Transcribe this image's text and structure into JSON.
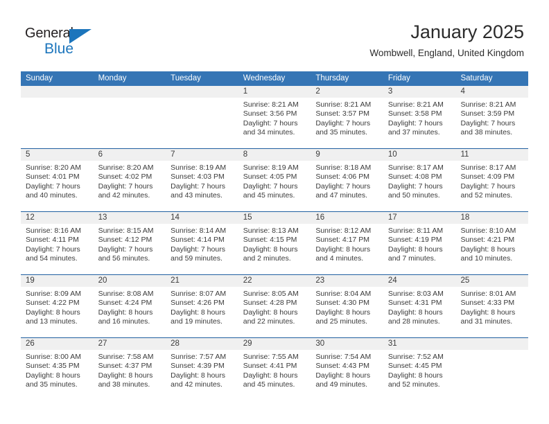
{
  "brand": {
    "name_part1": "General",
    "name_part2": "Blue",
    "triangle_icon": "triangle-logo-icon",
    "color_dark": "#231f20",
    "color_blue": "#1c75bc"
  },
  "header": {
    "title": "January 2025",
    "subtitle": "Wombwell, England, United Kingdom"
  },
  "theme": {
    "header_blue": "#3575B5",
    "separator_blue": "#1F5FA0",
    "daynum_band": "#f0f0f0",
    "text": "#3a3a3a"
  },
  "weekdays": [
    "Sunday",
    "Monday",
    "Tuesday",
    "Wednesday",
    "Thursday",
    "Friday",
    "Saturday"
  ],
  "labels": {
    "sunrise_prefix": "Sunrise: ",
    "sunset_prefix": "Sunset: ",
    "daylight_prefix": "Daylight: "
  },
  "weeks": [
    {
      "days": [
        {
          "num": "",
          "empty": true
        },
        {
          "num": "",
          "empty": true
        },
        {
          "num": "",
          "empty": true
        },
        {
          "num": "1",
          "sunrise": "Sunrise: 8:21 AM",
          "sunset": "Sunset: 3:56 PM",
          "daylight_1": "Daylight: 7 hours",
          "daylight_2": "and 34 minutes."
        },
        {
          "num": "2",
          "sunrise": "Sunrise: 8:21 AM",
          "sunset": "Sunset: 3:57 PM",
          "daylight_1": "Daylight: 7 hours",
          "daylight_2": "and 35 minutes."
        },
        {
          "num": "3",
          "sunrise": "Sunrise: 8:21 AM",
          "sunset": "Sunset: 3:58 PM",
          "daylight_1": "Daylight: 7 hours",
          "daylight_2": "and 37 minutes."
        },
        {
          "num": "4",
          "sunrise": "Sunrise: 8:21 AM",
          "sunset": "Sunset: 3:59 PM",
          "daylight_1": "Daylight: 7 hours",
          "daylight_2": "and 38 minutes."
        }
      ]
    },
    {
      "days": [
        {
          "num": "5",
          "sunrise": "Sunrise: 8:20 AM",
          "sunset": "Sunset: 4:01 PM",
          "daylight_1": "Daylight: 7 hours",
          "daylight_2": "and 40 minutes."
        },
        {
          "num": "6",
          "sunrise": "Sunrise: 8:20 AM",
          "sunset": "Sunset: 4:02 PM",
          "daylight_1": "Daylight: 7 hours",
          "daylight_2": "and 42 minutes."
        },
        {
          "num": "7",
          "sunrise": "Sunrise: 8:19 AM",
          "sunset": "Sunset: 4:03 PM",
          "daylight_1": "Daylight: 7 hours",
          "daylight_2": "and 43 minutes."
        },
        {
          "num": "8",
          "sunrise": "Sunrise: 8:19 AM",
          "sunset": "Sunset: 4:05 PM",
          "daylight_1": "Daylight: 7 hours",
          "daylight_2": "and 45 minutes."
        },
        {
          "num": "9",
          "sunrise": "Sunrise: 8:18 AM",
          "sunset": "Sunset: 4:06 PM",
          "daylight_1": "Daylight: 7 hours",
          "daylight_2": "and 47 minutes."
        },
        {
          "num": "10",
          "sunrise": "Sunrise: 8:17 AM",
          "sunset": "Sunset: 4:08 PM",
          "daylight_1": "Daylight: 7 hours",
          "daylight_2": "and 50 minutes."
        },
        {
          "num": "11",
          "sunrise": "Sunrise: 8:17 AM",
          "sunset": "Sunset: 4:09 PM",
          "daylight_1": "Daylight: 7 hours",
          "daylight_2": "and 52 minutes."
        }
      ]
    },
    {
      "days": [
        {
          "num": "12",
          "sunrise": "Sunrise: 8:16 AM",
          "sunset": "Sunset: 4:11 PM",
          "daylight_1": "Daylight: 7 hours",
          "daylight_2": "and 54 minutes."
        },
        {
          "num": "13",
          "sunrise": "Sunrise: 8:15 AM",
          "sunset": "Sunset: 4:12 PM",
          "daylight_1": "Daylight: 7 hours",
          "daylight_2": "and 56 minutes."
        },
        {
          "num": "14",
          "sunrise": "Sunrise: 8:14 AM",
          "sunset": "Sunset: 4:14 PM",
          "daylight_1": "Daylight: 7 hours",
          "daylight_2": "and 59 minutes."
        },
        {
          "num": "15",
          "sunrise": "Sunrise: 8:13 AM",
          "sunset": "Sunset: 4:15 PM",
          "daylight_1": "Daylight: 8 hours",
          "daylight_2": "and 2 minutes."
        },
        {
          "num": "16",
          "sunrise": "Sunrise: 8:12 AM",
          "sunset": "Sunset: 4:17 PM",
          "daylight_1": "Daylight: 8 hours",
          "daylight_2": "and 4 minutes."
        },
        {
          "num": "17",
          "sunrise": "Sunrise: 8:11 AM",
          "sunset": "Sunset: 4:19 PM",
          "daylight_1": "Daylight: 8 hours",
          "daylight_2": "and 7 minutes."
        },
        {
          "num": "18",
          "sunrise": "Sunrise: 8:10 AM",
          "sunset": "Sunset: 4:21 PM",
          "daylight_1": "Daylight: 8 hours",
          "daylight_2": "and 10 minutes."
        }
      ]
    },
    {
      "days": [
        {
          "num": "19",
          "sunrise": "Sunrise: 8:09 AM",
          "sunset": "Sunset: 4:22 PM",
          "daylight_1": "Daylight: 8 hours",
          "daylight_2": "and 13 minutes."
        },
        {
          "num": "20",
          "sunrise": "Sunrise: 8:08 AM",
          "sunset": "Sunset: 4:24 PM",
          "daylight_1": "Daylight: 8 hours",
          "daylight_2": "and 16 minutes."
        },
        {
          "num": "21",
          "sunrise": "Sunrise: 8:07 AM",
          "sunset": "Sunset: 4:26 PM",
          "daylight_1": "Daylight: 8 hours",
          "daylight_2": "and 19 minutes."
        },
        {
          "num": "22",
          "sunrise": "Sunrise: 8:05 AM",
          "sunset": "Sunset: 4:28 PM",
          "daylight_1": "Daylight: 8 hours",
          "daylight_2": "and 22 minutes."
        },
        {
          "num": "23",
          "sunrise": "Sunrise: 8:04 AM",
          "sunset": "Sunset: 4:30 PM",
          "daylight_1": "Daylight: 8 hours",
          "daylight_2": "and 25 minutes."
        },
        {
          "num": "24",
          "sunrise": "Sunrise: 8:03 AM",
          "sunset": "Sunset: 4:31 PM",
          "daylight_1": "Daylight: 8 hours",
          "daylight_2": "and 28 minutes."
        },
        {
          "num": "25",
          "sunrise": "Sunrise: 8:01 AM",
          "sunset": "Sunset: 4:33 PM",
          "daylight_1": "Daylight: 8 hours",
          "daylight_2": "and 31 minutes."
        }
      ]
    },
    {
      "days": [
        {
          "num": "26",
          "sunrise": "Sunrise: 8:00 AM",
          "sunset": "Sunset: 4:35 PM",
          "daylight_1": "Daylight: 8 hours",
          "daylight_2": "and 35 minutes."
        },
        {
          "num": "27",
          "sunrise": "Sunrise: 7:58 AM",
          "sunset": "Sunset: 4:37 PM",
          "daylight_1": "Daylight: 8 hours",
          "daylight_2": "and 38 minutes."
        },
        {
          "num": "28",
          "sunrise": "Sunrise: 7:57 AM",
          "sunset": "Sunset: 4:39 PM",
          "daylight_1": "Daylight: 8 hours",
          "daylight_2": "and 42 minutes."
        },
        {
          "num": "29",
          "sunrise": "Sunrise: 7:55 AM",
          "sunset": "Sunset: 4:41 PM",
          "daylight_1": "Daylight: 8 hours",
          "daylight_2": "and 45 minutes."
        },
        {
          "num": "30",
          "sunrise": "Sunrise: 7:54 AM",
          "sunset": "Sunset: 4:43 PM",
          "daylight_1": "Daylight: 8 hours",
          "daylight_2": "and 49 minutes."
        },
        {
          "num": "31",
          "sunrise": "Sunrise: 7:52 AM",
          "sunset": "Sunset: 4:45 PM",
          "daylight_1": "Daylight: 8 hours",
          "daylight_2": "and 52 minutes."
        },
        {
          "num": "",
          "empty": true
        }
      ]
    }
  ]
}
